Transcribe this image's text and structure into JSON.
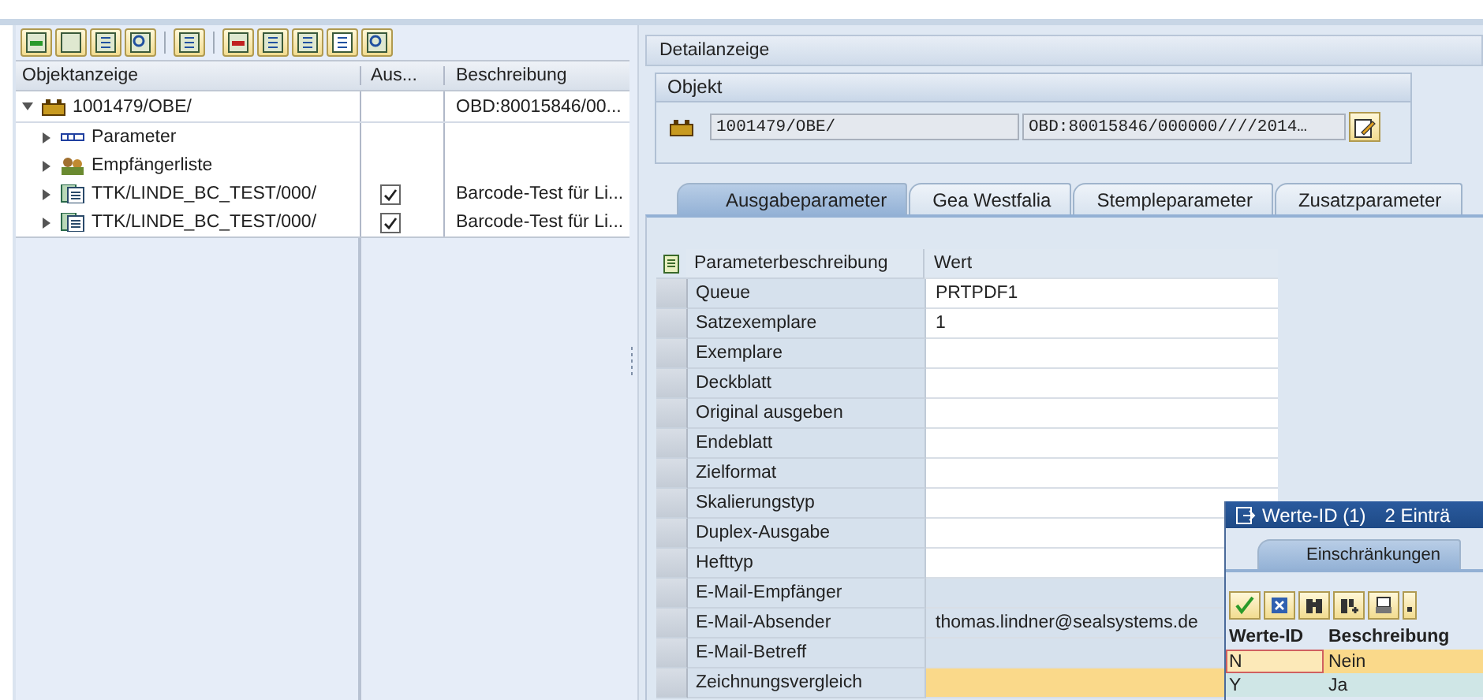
{
  "tree": {
    "columns": [
      "Objektanzeige",
      "Aus...",
      "Beschreibung"
    ],
    "nodes": [
      {
        "label": "1001479/OBE/",
        "description": "OBD:80015846/00...",
        "expanded": true,
        "kind": "object",
        "children": [
          {
            "label": "Parameter",
            "expanded": false,
            "kind": "parameter"
          },
          {
            "label": "Empfängerliste",
            "expanded": false,
            "kind": "recipients"
          },
          {
            "label": "TTK/LINDE_BC_TEST/000/",
            "checked": true,
            "description": "Barcode-Test für Li...",
            "expanded": false,
            "kind": "document"
          },
          {
            "label": "TTK/LINDE_BC_TEST/000/",
            "checked": true,
            "description": "Barcode-Test für Li...",
            "expanded": false,
            "kind": "document"
          }
        ]
      }
    ]
  },
  "detail": {
    "title": "Detailanzeige",
    "group_title": "Objekt",
    "object_id": "1001479/OBE/",
    "object_description": "OBD:80015846/000000////2014…",
    "tabs": [
      {
        "label": "Ausgabeparameter",
        "selected": true
      },
      {
        "label": "Gea Westfalia",
        "selected": false
      },
      {
        "label": "Stempleparameter",
        "selected": false
      },
      {
        "label": "Zusatzparameter",
        "selected": false
      }
    ],
    "table": {
      "columns": [
        "Parameterbeschreibung",
        "Wert"
      ],
      "rows": [
        {
          "name": "Queue",
          "value": "PRTPDF1",
          "editable": true,
          "selected": false
        },
        {
          "name": "Satzexemplare",
          "value": "1",
          "editable": true,
          "selected": false
        },
        {
          "name": "Exemplare",
          "editable": true,
          "selected": false
        },
        {
          "name": "Deckblatt",
          "editable": true,
          "selected": false
        },
        {
          "name": "Original ausgeben",
          "editable": true,
          "selected": false
        },
        {
          "name": "Endeblatt",
          "editable": true,
          "selected": false
        },
        {
          "name": "Zielformat",
          "editable": true,
          "selected": false
        },
        {
          "name": "Skalierungstyp",
          "editable": true,
          "selected": false
        },
        {
          "name": "Duplex-Ausgabe",
          "editable": true,
          "selected": false
        },
        {
          "name": "Hefttyp",
          "editable": true,
          "selected": false
        },
        {
          "name": "E-Mail-Empfänger",
          "editable": false,
          "selected": false
        },
        {
          "name": "E-Mail-Absender",
          "value": "thomas.lindner@sealsystems.de",
          "editable": false,
          "selected": false
        },
        {
          "name": "E-Mail-Betreff",
          "editable": false,
          "selected": false
        },
        {
          "name": "Zeichnungsvergleich",
          "editable": true,
          "selected": true
        }
      ]
    }
  },
  "popup": {
    "title": "Werte-ID (1)",
    "count": "2 Einträ",
    "tab": "Einschränkungen",
    "columns": [
      "Werte-ID",
      "Beschreibung"
    ],
    "rows": [
      {
        "id": "N",
        "description": "Nein",
        "selected": true
      },
      {
        "id": "Y",
        "description": "Ja",
        "selected": false
      }
    ]
  }
}
